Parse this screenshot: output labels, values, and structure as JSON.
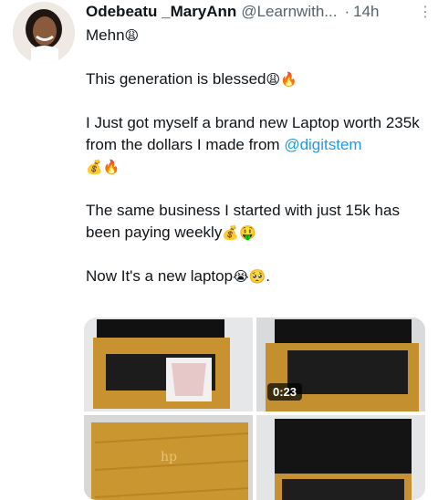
{
  "tweet": {
    "display_name": "Odebeatu _MaryAnn",
    "handle": "@Learnwith...",
    "separator": "·",
    "time": "14h",
    "more_icon": "more-options-icon",
    "line1_text": "Mehn",
    "line1_emoji": "😩",
    "line2_text": "This generation is blessed",
    "line2_emoji": "😩🔥",
    "line3_text": "I Just got myself a brand new Laptop worth 235k from the dollars I made from ",
    "mention": "@digitstem",
    "line3_emoji": "💰🔥",
    "line4_text": "The same business I started with just 15k has been paying weekly",
    "line4_emoji": "💰🤑",
    "line5_text": "Now It's a new laptop",
    "line5_emoji": "😭🥺",
    "line5_end": "."
  },
  "media": {
    "video_duration": "0:23",
    "accent_wood": "#c9952e",
    "accent_link": "#1d9bf0"
  }
}
